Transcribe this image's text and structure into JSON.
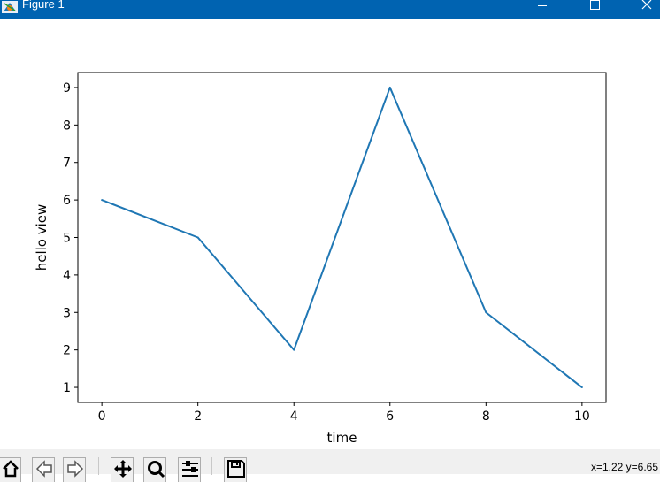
{
  "window": {
    "title": "Figure 1",
    "titlebar_color": "#0063b1",
    "icons": {
      "app": "matplotlib-icon",
      "minimize": "minimize-icon",
      "maximize": "maximize-icon",
      "close": "close-icon"
    }
  },
  "toolbar": {
    "buttons": [
      {
        "name": "home-button",
        "icon": "home-icon"
      },
      {
        "name": "back-button",
        "icon": "back-arrow-icon"
      },
      {
        "name": "forward-button",
        "icon": "forward-arrow-icon"
      },
      {
        "name": "pan-button",
        "icon": "pan-move-icon"
      },
      {
        "name": "zoom-button",
        "icon": "zoom-icon"
      },
      {
        "name": "configure-subplots-button",
        "icon": "subplots-icon"
      },
      {
        "name": "save-button",
        "icon": "save-icon"
      }
    ]
  },
  "status": {
    "coordinates": "x=1.22 y=6.65"
  },
  "chart_data": {
    "type": "line",
    "title": "",
    "xlabel": "time",
    "ylabel": "hello view",
    "x": [
      0,
      2,
      4,
      6,
      8,
      10
    ],
    "series": [
      {
        "values": [
          6,
          5,
          2,
          9,
          3,
          1
        ],
        "color": "#1f77b4"
      }
    ],
    "xticks": [
      0,
      2,
      4,
      6,
      8,
      10
    ],
    "yticks": [
      1,
      2,
      3,
      4,
      5,
      6,
      7,
      8,
      9
    ],
    "xlim": [
      -0.5,
      10.5
    ],
    "ylim": [
      0.6,
      9.4
    ],
    "grid": false,
    "legend": "none"
  }
}
